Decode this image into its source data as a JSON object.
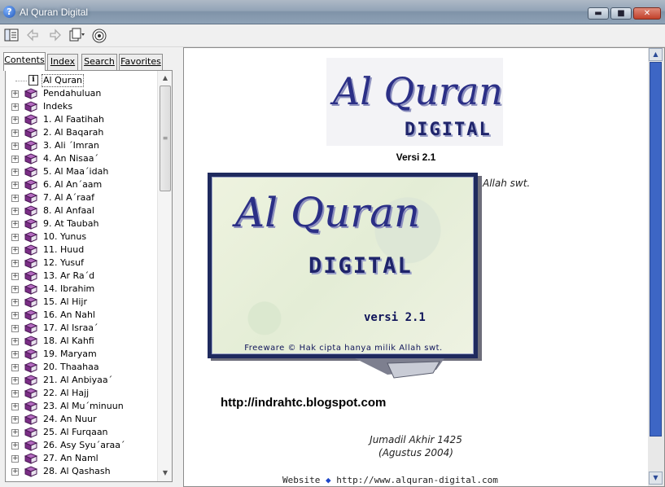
{
  "window": {
    "title": "Al Quran Digital",
    "app_icon": "?"
  },
  "titlebar_buttons": {
    "minimize": "▬",
    "maximize": "■",
    "close": "✕"
  },
  "toolbar": {
    "hide_icon": "hide-pane-icon",
    "back_icon": "back-arrow-icon",
    "forward_icon": "forward-arrow-icon",
    "options_icon": "options-icon",
    "web_icon": "web-icon"
  },
  "tabs": [
    {
      "label": "Contents",
      "active": true
    },
    {
      "label": "Index",
      "active": false
    },
    {
      "label": "Search",
      "active": false
    },
    {
      "label": "Favorites",
      "active": false
    }
  ],
  "tree": {
    "root": {
      "label": "Al Quran",
      "icon": "info-page-icon",
      "selected": true
    },
    "items": [
      "Pendahuluan",
      "Indeks",
      "1. Al Faatihah",
      "2. Al Baqarah",
      "3. Ali ´Imran",
      "4. An Nisaa´",
      "5. Al Maa´idah",
      "6. Al An´aam",
      "7. Al A´raaf",
      "8. Al Anfaal",
      "9. At Taubah",
      "10. Yunus",
      "11. Huud",
      "12. Yusuf",
      "13. Ar Ra´d",
      "14. Ibrahim",
      "15. Al Hijr",
      "16. An Nahl",
      "17. Al Israa´",
      "18. Al Kahfi",
      "19. Maryam",
      "20. Thaahaa",
      "21. Al Anbiyaa´",
      "22. Al Hajj",
      "23. Al Mu´minuun",
      "24. An Nuur",
      "25. Al Furqaan",
      "26. Asy Syu´araa´",
      "27. An Naml",
      "28. Al Qashash"
    ]
  },
  "content": {
    "logo_title": "Al Quran",
    "logo_sub": "DIGITAL",
    "versi_small": "Versi 2.1",
    "splash": {
      "title": "Al Quran",
      "sub": "DIGITAL",
      "versi": "versi 2.1",
      "freeware": "Freeware © Hak cipta hanya milik Allah swt."
    },
    "allah_text": "Allah swt.",
    "blog_url": "http://indrahtc.blogspot.com",
    "date_hijri": "Jumadil Akhir 1425",
    "date_greg": "(Agustus 2004)",
    "website_label": "Website",
    "website_bullet": "◆",
    "website_url": "http://www.alquran-digital.com"
  },
  "colors": {
    "accent": "#2b2f86",
    "book": "#7b2d86",
    "scroll_thumb": "#3d66c5"
  }
}
